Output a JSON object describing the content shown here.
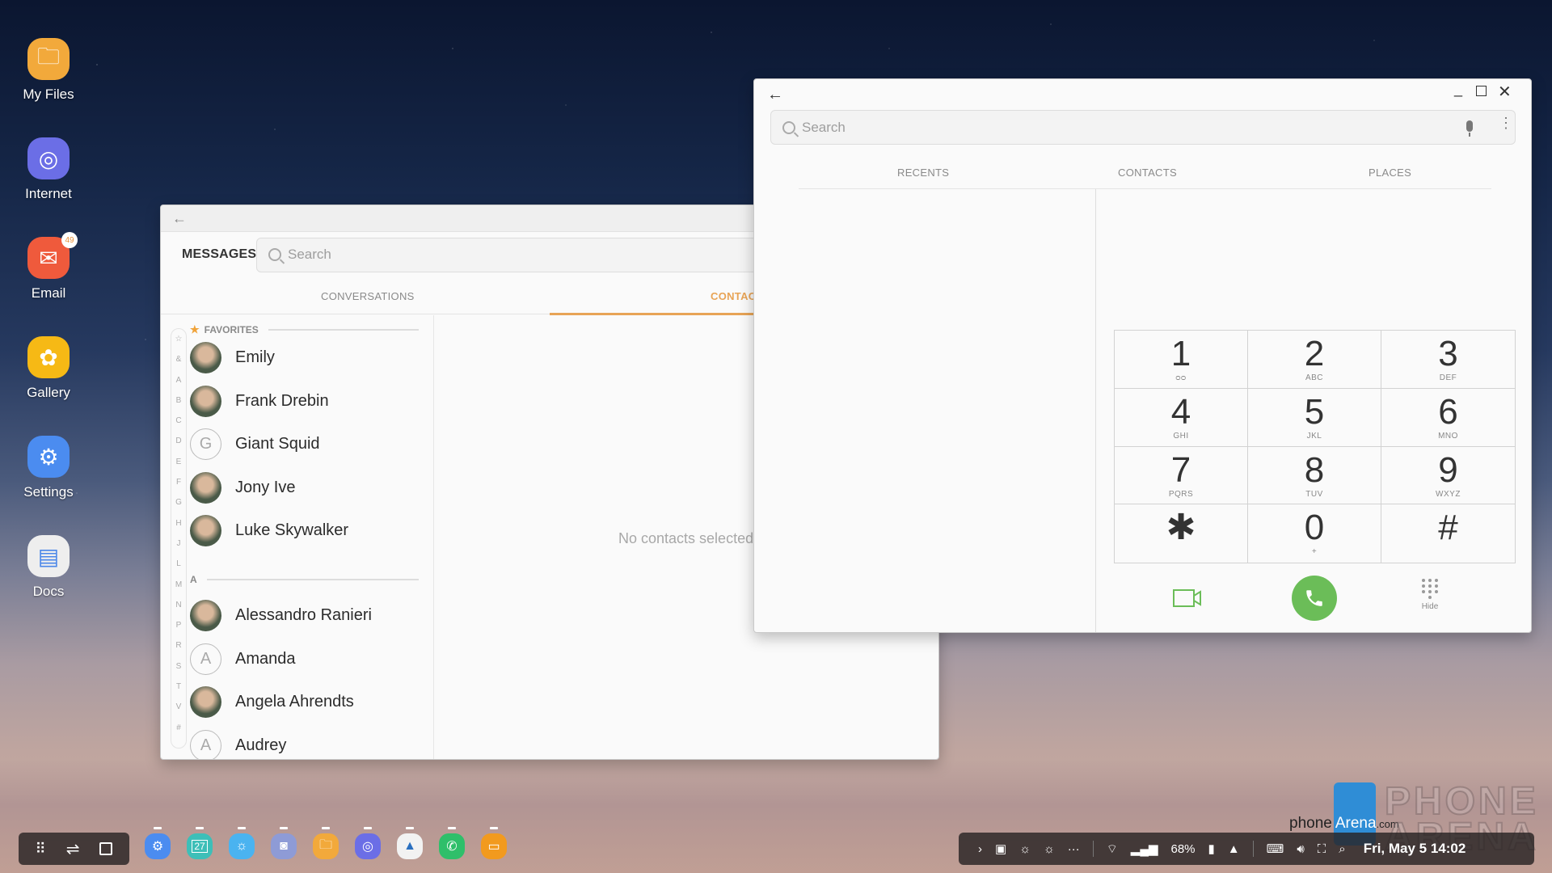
{
  "desktop": {
    "icons": [
      {
        "label": "My Files",
        "icon": "folder-icon",
        "color": "#f2a93b"
      },
      {
        "label": "Internet",
        "icon": "planet-icon",
        "color": "#6b6ee6"
      },
      {
        "label": "Email",
        "icon": "mail-icon",
        "color": "#ef5a3c",
        "badge": "49"
      },
      {
        "label": "Gallery",
        "icon": "flower-icon",
        "color": "#f6b915"
      },
      {
        "label": "Settings",
        "icon": "gear-icon",
        "color": "#4b8cf0"
      },
      {
        "label": "Docs",
        "icon": "docs-icon",
        "color": "#eeeeee"
      }
    ]
  },
  "messages": {
    "title": "MESSAGES",
    "search_placeholder": "Search",
    "tabs": [
      {
        "label": "CONVERSATIONS",
        "active": false
      },
      {
        "label": "CONTACTS",
        "active": true
      }
    ],
    "accent": "#e8a456",
    "index_letters": [
      "☆",
      "&",
      "A",
      "B",
      "C",
      "D",
      "E",
      "F",
      "G",
      "H",
      "J",
      "L",
      "M",
      "N",
      "P",
      "R",
      "S",
      "T",
      "V",
      "#"
    ],
    "favorites_label": "FAVORITES",
    "favorites": [
      {
        "name": "Emily",
        "avatar": "photo"
      },
      {
        "name": "Frank Drebin",
        "avatar": "photo"
      },
      {
        "name": "Giant Squid",
        "avatar": "G"
      },
      {
        "name": "Jony Ive",
        "avatar": "photo"
      },
      {
        "name": "Luke Skywalker",
        "avatar": "photo"
      }
    ],
    "section_a_label": "A",
    "contacts_a": [
      {
        "name": "Alessandro Ranieri",
        "avatar": "photo"
      },
      {
        "name": "Amanda",
        "avatar": "A"
      },
      {
        "name": "Angela Ahrendts",
        "avatar": "photo"
      },
      {
        "name": "Audrey",
        "avatar": "A"
      }
    ],
    "empty_state": "No contacts selected"
  },
  "phone": {
    "search_placeholder": "Search",
    "tabs": [
      "RECENTS",
      "CONTACTS",
      "PLACES"
    ],
    "keypad": [
      {
        "digit": "1",
        "letters": "ᴑᴑ"
      },
      {
        "digit": "2",
        "letters": "ABC"
      },
      {
        "digit": "3",
        "letters": "DEF"
      },
      {
        "digit": "4",
        "letters": "GHI"
      },
      {
        "digit": "5",
        "letters": "JKL"
      },
      {
        "digit": "6",
        "letters": "MNO"
      },
      {
        "digit": "7",
        "letters": "PQRS"
      },
      {
        "digit": "8",
        "letters": "TUV"
      },
      {
        "digit": "9",
        "letters": "WXYZ"
      },
      {
        "digit": "✱",
        "letters": ""
      },
      {
        "digit": "0",
        "letters": "+"
      },
      {
        "digit": "#",
        "letters": ""
      }
    ],
    "hide_label": "Hide",
    "call_color": "#6bbd58"
  },
  "taskbar": {
    "apps": [
      {
        "name": "settings",
        "color": "#4b8cf0"
      },
      {
        "name": "calendar",
        "color": "#3dbfb8",
        "text": "27"
      },
      {
        "name": "weather",
        "color": "#4ab3f0"
      },
      {
        "name": "camera",
        "color": "#8e9bd6"
      },
      {
        "name": "my-files",
        "color": "#f2a93b"
      },
      {
        "name": "internet",
        "color": "#6b6ee6"
      },
      {
        "name": "gallery-photo",
        "color": "#f2f2f2"
      },
      {
        "name": "phone",
        "color": "#2fbf6a"
      },
      {
        "name": "messages",
        "color": "#f29a1e"
      }
    ],
    "battery": "68%",
    "clock": "Fri, May 5 14:02"
  },
  "watermark": {
    "phone": "phone",
    "arena": "Arena",
    "com": ".com",
    "big": "PHONE ARENA"
  }
}
